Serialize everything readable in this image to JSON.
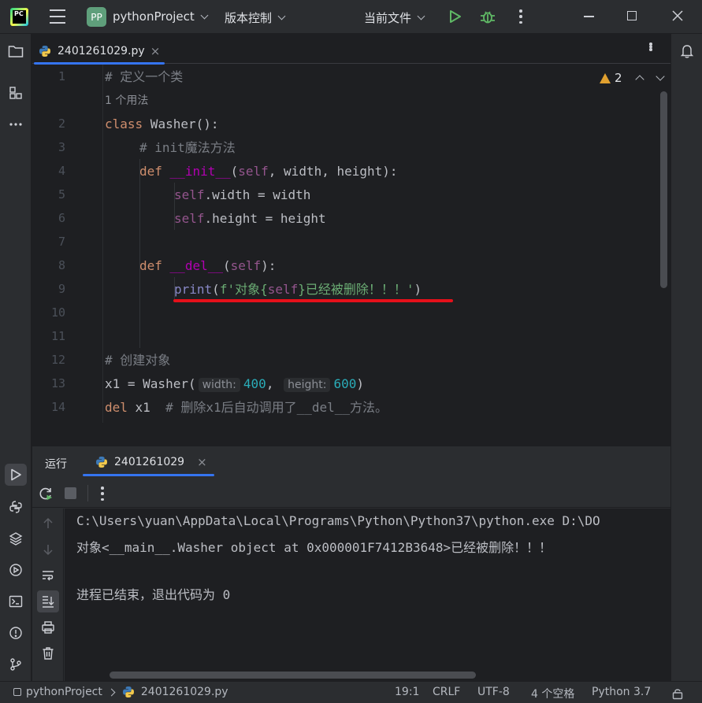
{
  "titlebar": {
    "logo_text": "PC",
    "project_badge": "PP",
    "project_name": "pythonProject",
    "vcs_label": "版本控制",
    "run_config": "当前文件"
  },
  "editor_tab": {
    "filename": "2401261029.py",
    "close": "×"
  },
  "inspection": {
    "warning_count": "2",
    "warning_color": "#e0a02f"
  },
  "code": {
    "line_numbers": [
      "1",
      "2",
      "3",
      "4",
      "5",
      "6",
      "7",
      "8",
      "9",
      "10",
      "11",
      "12",
      "13",
      "14"
    ],
    "usage_hint": "1 个用法",
    "l1": "# 定义一个类",
    "l2_kw": "class",
    "l2_name": " Washer",
    "l2_rest": "():",
    "l3": "# init魔法方法",
    "l4_kw": "def",
    "l4_name": "__init__",
    "l4_open": "(",
    "l4_self": "self",
    "l4_rest": ", width, height):",
    "l5_self": "self",
    "l5_rest": ".width = width",
    "l6_self": "self",
    "l6_rest": ".height = height",
    "l8_kw": "def",
    "l8_name": "__del__",
    "l8_open": "(",
    "l8_self": "self",
    "l8_rest": "):",
    "l9_print": "print",
    "l9_open": "(",
    "l9_s1": "f'对象{",
    "l9_self": "self",
    "l9_s2": "}已经被删除！！！'",
    "l9_close": ")",
    "l12": "# 创建对象",
    "l13_a": "x1 = Washer(",
    "l13_h1": "width:",
    "l13_v1": "400",
    "l13_comma": ",",
    "l13_h2": "height:",
    "l13_v2": "600",
    "l13_close": ")",
    "l14_kw": "del",
    "l14_rest": " x1  ",
    "l14_cm": "# 删除x1后自动调用了__del__方法。"
  },
  "run_panel": {
    "tab_label": "运行",
    "file_tab": "2401261029",
    "close": "×",
    "output": [
      "C:\\Users\\yuan\\AppData\\Local\\Programs\\Python\\Python37\\python.exe D:\\DO",
      "对象<__main__.Washer object at 0x000001F7412B3648>已经被删除！！！",
      "",
      "进程已结束，退出代码为 0"
    ]
  },
  "statusbar": {
    "project": "pythonProject",
    "file": "2401261029.py",
    "position": "19:1",
    "line_sep": "CRLF",
    "encoding": "UTF-8",
    "indent": "4 个空格",
    "interpreter": "Python 3.7"
  }
}
